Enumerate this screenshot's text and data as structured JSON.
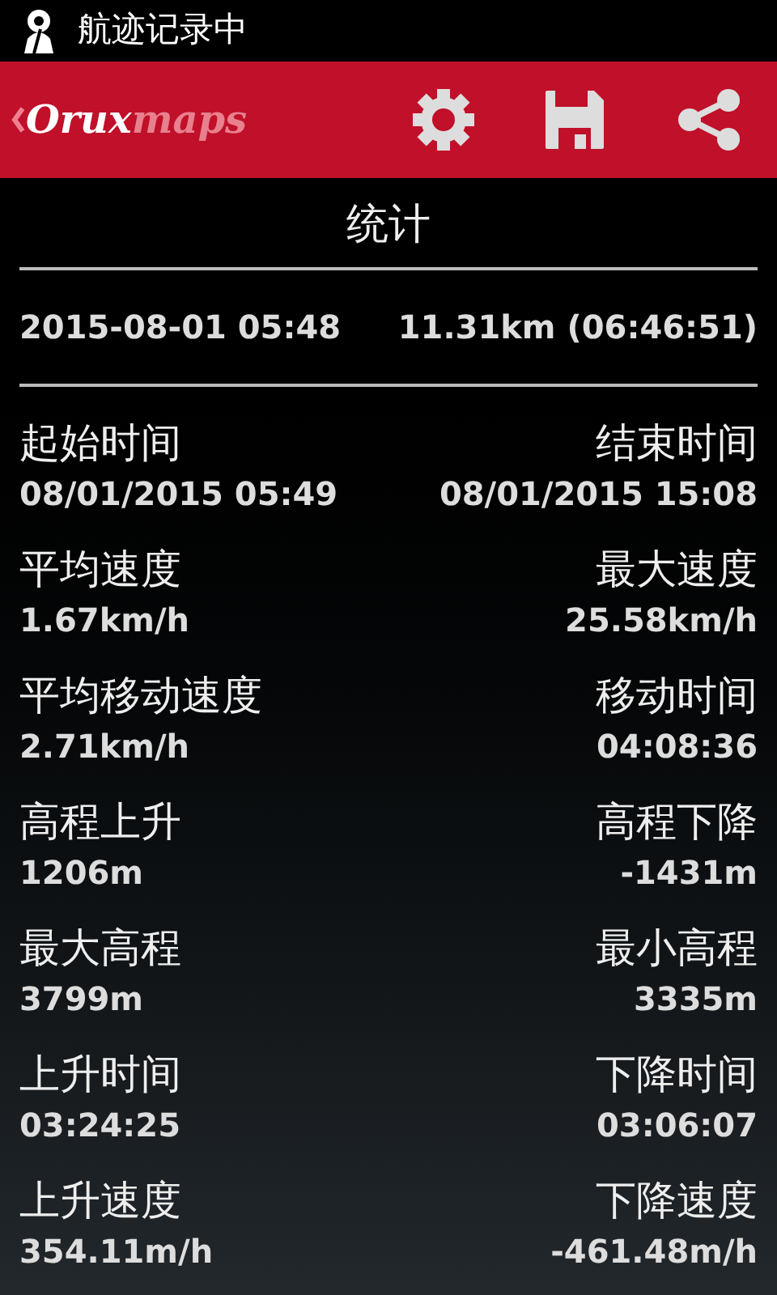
{
  "status_bar": {
    "notification": "航迹记录中"
  },
  "app_bar": {
    "logo_primary": "Orux",
    "logo_secondary": "maps"
  },
  "title": "统计",
  "summary": {
    "date": "2015-08-01 05:48",
    "distance": "11.31km (06:46:51)"
  },
  "stats": [
    {
      "left_label": "起始时间",
      "left_value": "08/01/2015 05:49",
      "right_label": "结束时间",
      "right_value": "08/01/2015 15:08"
    },
    {
      "left_label": "平均速度",
      "left_value": "1.67km/h",
      "right_label": "最大速度",
      "right_value": "25.58km/h"
    },
    {
      "left_label": "平均移动速度",
      "left_value": "2.71km/h",
      "right_label": "移动时间",
      "right_value": "04:08:36"
    },
    {
      "left_label": "高程上升",
      "left_value": "1206m",
      "right_label": "高程下降",
      "right_value": "-1431m"
    },
    {
      "left_label": "最大高程",
      "left_value": "3799m",
      "right_label": "最小高程",
      "right_value": "3335m"
    },
    {
      "left_label": "上升时间",
      "left_value": "03:24:25",
      "right_label": "下降时间",
      "right_value": "03:06:07"
    },
    {
      "left_label": "上升速度",
      "left_value": "354.11m/h",
      "right_label": "下降速度",
      "right_value": "-461.48m/h"
    }
  ]
}
